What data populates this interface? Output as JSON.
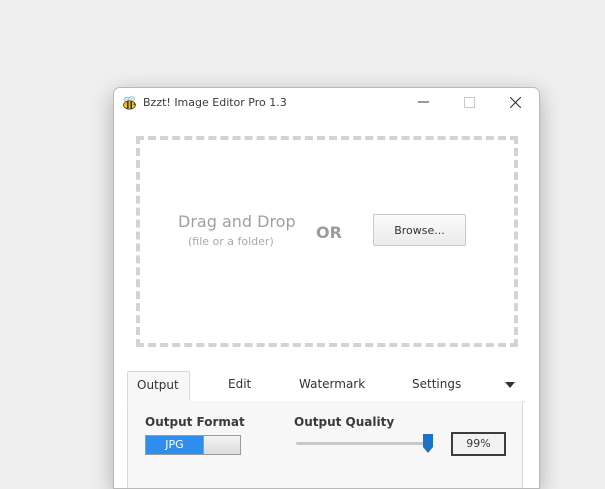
{
  "window": {
    "title": "Bzzt! Image Editor Pro 1.3"
  },
  "titlebar": {
    "icons": [
      "bee-icon",
      "minimize-icon",
      "maximize-icon",
      "close-icon"
    ]
  },
  "dropzone": {
    "title": "Drag and Drop",
    "subtitle": "(file or a folder)",
    "or_text": "OR",
    "browse_label": "Browse..."
  },
  "tabs": [
    {
      "label": "Output",
      "active": true
    },
    {
      "label": "Edit",
      "active": false
    },
    {
      "label": "Watermark",
      "active": false
    },
    {
      "label": "Settings",
      "active": false
    }
  ],
  "output": {
    "format_label": "Output Format",
    "format_value": "JPG",
    "quality_label": "Output Quality",
    "quality_value": "99%",
    "quality_fraction": 0.99
  },
  "colors": {
    "accent": "#2f8ded",
    "slider_thumb": "#1a73c9",
    "dash_border": "#d3d3d3"
  }
}
